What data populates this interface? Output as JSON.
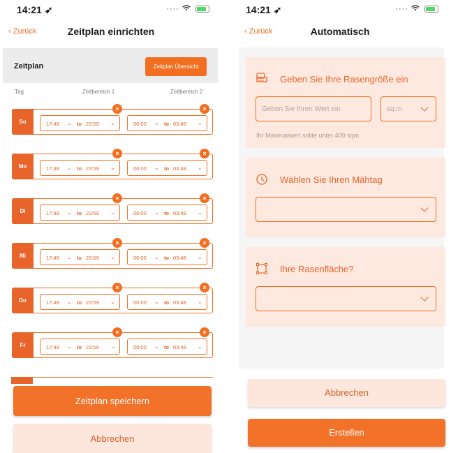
{
  "left": {
    "status": {
      "time": "14:21 ➶"
    },
    "nav": {
      "back": "Zurück",
      "title": "Zeitplan einrichten"
    },
    "schedule": {
      "label": "Zeitplan",
      "overview_button": "Zeitplan Übersicht"
    },
    "columns": {
      "day": "Tag",
      "range1": "Zeitbereich 1",
      "range2": "Zeitbereich 2"
    },
    "to_label": "to",
    "days": [
      {
        "tag": "So",
        "r1_from": "17:48",
        "r1_to": "23:59",
        "r2_from": "00:00",
        "r2_to": "03:48"
      },
      {
        "tag": "Mo",
        "r1_from": "17:48",
        "r1_to": "23:59",
        "r2_from": "00:00",
        "r2_to": "03:48"
      },
      {
        "tag": "Di",
        "r1_from": "17:48",
        "r1_to": "23:59",
        "r2_from": "00:00",
        "r2_to": "03:48"
      },
      {
        "tag": "Mi",
        "r1_from": "17:48",
        "r1_to": "23:59",
        "r2_from": "00:00",
        "r2_to": "03:48"
      },
      {
        "tag": "Do",
        "r1_from": "17:48",
        "r1_to": "23:59",
        "r2_from": "00:00",
        "r2_to": "03:48"
      },
      {
        "tag": "Fr",
        "r1_from": "17:48",
        "r1_to": "23:59",
        "r2_from": "00:00",
        "r2_to": "03:48"
      }
    ],
    "save_button": "Zeitplan speichern",
    "cancel_button": "Abbrechen"
  },
  "right": {
    "status": {
      "time": "14:21 ➶"
    },
    "nav": {
      "back": "Zurück",
      "title": "Automatisch"
    },
    "lawn_size": {
      "title": "Geben Sie Ihre Rasengröße ein",
      "placeholder": "Geben Sie Ihren Wert ein",
      "unit": "sq.m",
      "hint": "Ihr Maximalwert sollte unter 400 sqm"
    },
    "mow_day": {
      "title": "Wählen Sie Ihren Mähtag",
      "value": ""
    },
    "lawn_area": {
      "title": "Ihre Rasenfläche?",
      "value": ""
    },
    "cancel_button": "Abbrechen",
    "create_button": "Erstellen"
  },
  "colors": {
    "accent": "#f26f22",
    "card_bg": "#fde9df",
    "header_bg": "#ececec"
  },
  "icons": [
    "wifi-icon",
    "battery-icon",
    "chevron-left-icon",
    "chevron-down-icon",
    "close-icon",
    "ruler-icon",
    "clock-icon",
    "area-icon"
  ]
}
